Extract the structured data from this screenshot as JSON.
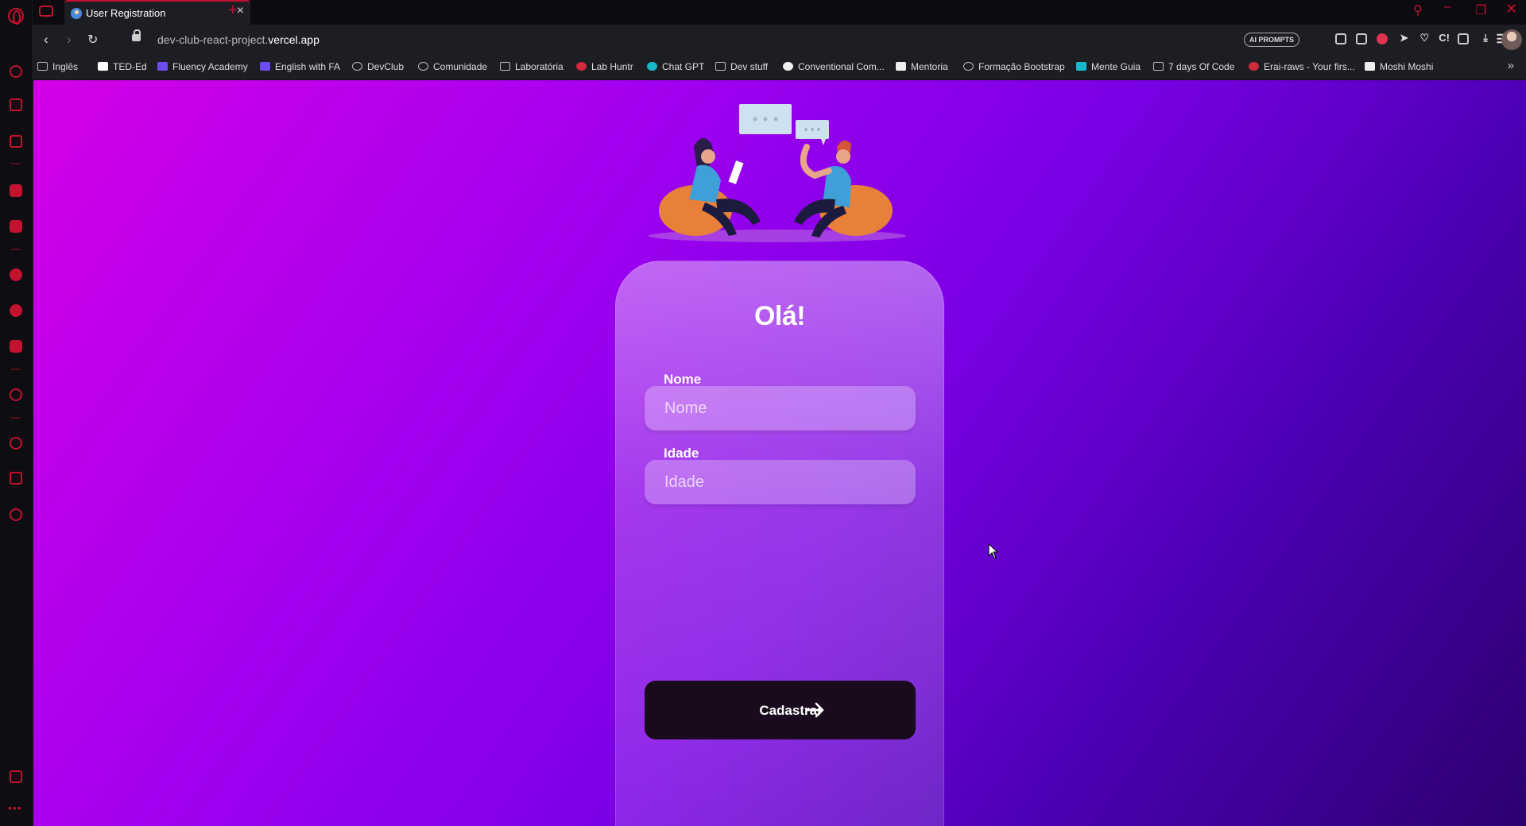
{
  "browser": {
    "tab_title": "User Registration",
    "url_prefix": "dev-club-react-project.",
    "url_domain": "vercel.app",
    "ai_prompts_label": "AI PROMPTS",
    "accent": "#c3122d"
  },
  "bookmarks": [
    {
      "label": "Inglês",
      "icon": "folder-icon"
    },
    {
      "label": "TED-Ed",
      "icon": "ted-icon"
    },
    {
      "label": "Fluency Academy",
      "icon": "f-icon"
    },
    {
      "label": "English with FA",
      "icon": "f-icon"
    },
    {
      "label": "DevClub",
      "icon": "devclub-icon"
    },
    {
      "label": "Comunidade",
      "icon": "devclub-icon"
    },
    {
      "label": "Laboratória",
      "icon": "folder-icon"
    },
    {
      "label": "Lab Huntr",
      "icon": "huntr-icon"
    },
    {
      "label": "Chat GPT",
      "icon": "openai-icon"
    },
    {
      "label": "Dev stuff",
      "icon": "folder-icon"
    },
    {
      "label": "Conventional Com...",
      "icon": "medium-icon"
    },
    {
      "label": "Mentoria",
      "icon": "notion-icon"
    },
    {
      "label": "Formação Bootstrap",
      "icon": "alura-icon"
    },
    {
      "label": "Mente Guia",
      "icon": "menteguia-icon"
    },
    {
      "label": "7 days Of Code",
      "icon": "question-icon"
    },
    {
      "label": "Erai-raws - Your firs...",
      "icon": "erai-icon"
    },
    {
      "label": "Moshi Moshi",
      "icon": "page-icon"
    }
  ],
  "page": {
    "heading": "Olá!",
    "name_label": "Nome",
    "name_placeholder": "Nome",
    "age_label": "Idade",
    "age_placeholder": "Idade",
    "submit_label": "Cadastrar",
    "gradient_start": "#d400e6",
    "gradient_end": "#2c0070",
    "button_color": "#1a0a1d"
  }
}
